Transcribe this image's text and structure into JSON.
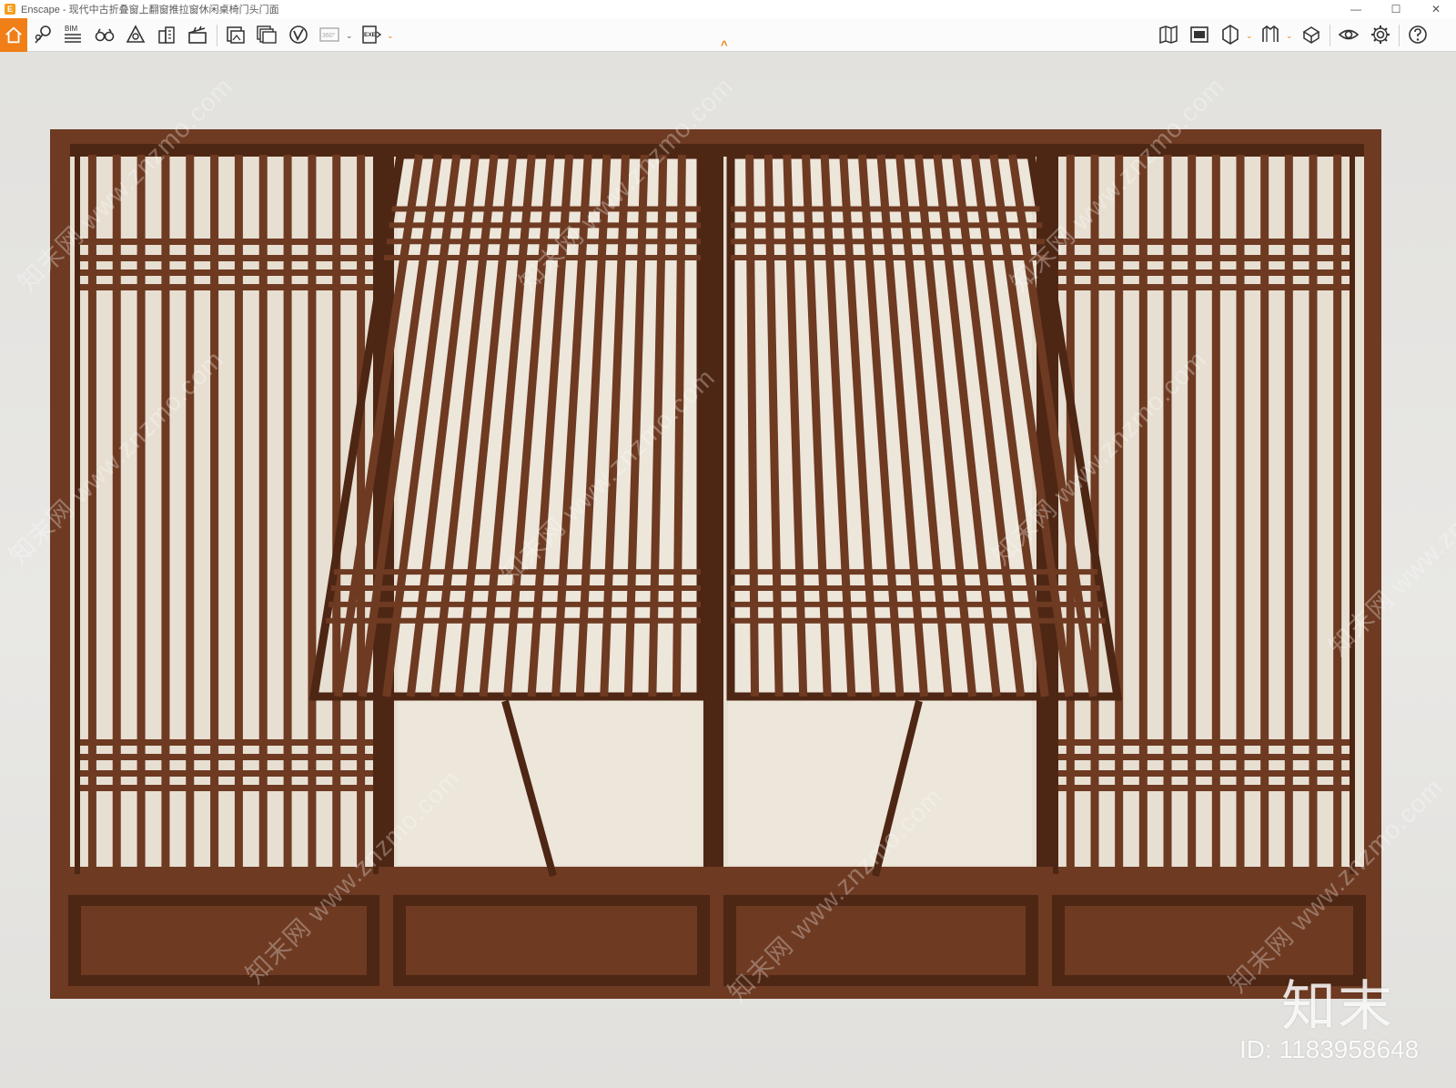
{
  "window": {
    "title": "Enscape - 现代中古折叠窗上翻窗推拉窗休闲桌椅门头门面",
    "logo_letter": "E",
    "minimize": "—",
    "maximize": "☐",
    "close": "✕"
  },
  "toolbar": {
    "home_icon": "home-icon",
    "bim_label": "BIM",
    "panorama_label": "360°",
    "exe_label": "EXE",
    "left_tools": [
      "home-icon",
      "location-pins-icon",
      "bim-list-icon",
      "binoculars-icon",
      "atmosphere-triangle-icon",
      "buildings-icon",
      "clapperboard-icon",
      "render-screenshot-icon",
      "batch-render-icon",
      "vr-icon",
      "panorama-360-icon",
      "export-exe-icon"
    ],
    "right_tools": [
      "map-info-icon",
      "uploads-icon",
      "view-mode-icon",
      "material-editor-icon",
      "asset-library-icon",
      "visual-settings-eye-icon",
      "settings-gear-icon",
      "help-icon"
    ],
    "collapse_icon": "chevron-up-icon"
  },
  "viewport": {
    "colors": {
      "wood": "#6e3a22",
      "wood_dark": "#4e2614",
      "wood_light": "#8a4e2f",
      "glass": "#e7dfd2",
      "wall": "#e6e5e2"
    },
    "watermark_text": "知末网 www.znzmo.com",
    "logo_text": "知末",
    "id_text": "ID: 1183958648"
  }
}
